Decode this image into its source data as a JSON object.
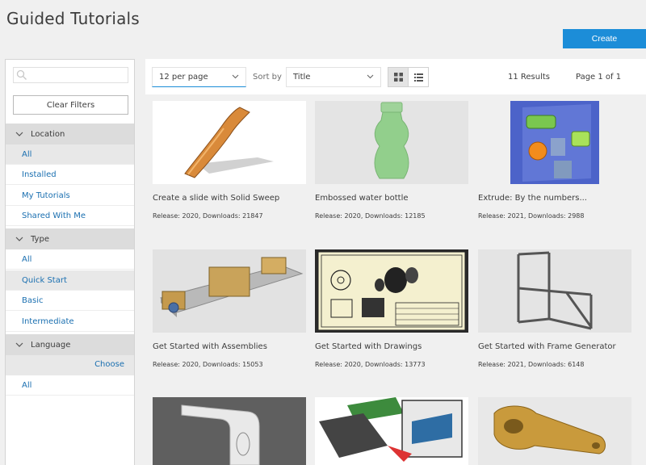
{
  "page": {
    "title": "Guided Tutorials",
    "create_label": "Create"
  },
  "sidebar": {
    "search": {
      "placeholder": ""
    },
    "clear_filters": "Clear Filters",
    "location": {
      "title": "Location",
      "items": [
        "All",
        "Installed",
        "My Tutorials",
        "Shared With Me"
      ],
      "selected": "All"
    },
    "type": {
      "title": "Type",
      "items": [
        "All",
        "Quick Start",
        "Basic",
        "Intermediate"
      ],
      "selected": "Quick Start"
    },
    "language": {
      "title": "Language",
      "choose": "Choose",
      "items": [
        "All"
      ]
    }
  },
  "toolbar": {
    "per_page": "12  per page",
    "sort_by_label": "Sort by",
    "sort_value": "Title",
    "results": "11 Results",
    "page": "Page 1 of 1"
  },
  "cards": [
    {
      "title": "Create a slide with Solid Sweep",
      "meta": "Release: 2020, Downloads: 21847",
      "icon": "slide-thumbnail"
    },
    {
      "title": "Embossed water bottle",
      "meta": "Release: 2020, Downloads: 12185",
      "icon": "bottle-thumbnail"
    },
    {
      "title": "Extrude: By the numbers...",
      "meta": "Release: 2021, Downloads: 2988",
      "icon": "numbers-thumbnail"
    },
    {
      "title": "Get Started with Assemblies",
      "meta": "Release: 2020, Downloads: 15053",
      "icon": "assembly-thumbnail"
    },
    {
      "title": "Get Started with Drawings",
      "meta": "Release: 2020, Downloads: 13773",
      "icon": "drawing-thumbnail"
    },
    {
      "title": "Get Started with Frame Generator",
      "meta": "Release: 2021, Downloads: 6148",
      "icon": "frame-thumbnail"
    },
    {
      "title": "",
      "meta": "",
      "icon": "sheetmetal-thumbnail"
    },
    {
      "title": "",
      "meta": "",
      "icon": "machine-thumbnail"
    },
    {
      "title": "",
      "meta": "",
      "icon": "bracket-thumbnail"
    }
  ],
  "colors": {
    "accent": "#1c8dd8",
    "link": "#1a6fb0"
  }
}
